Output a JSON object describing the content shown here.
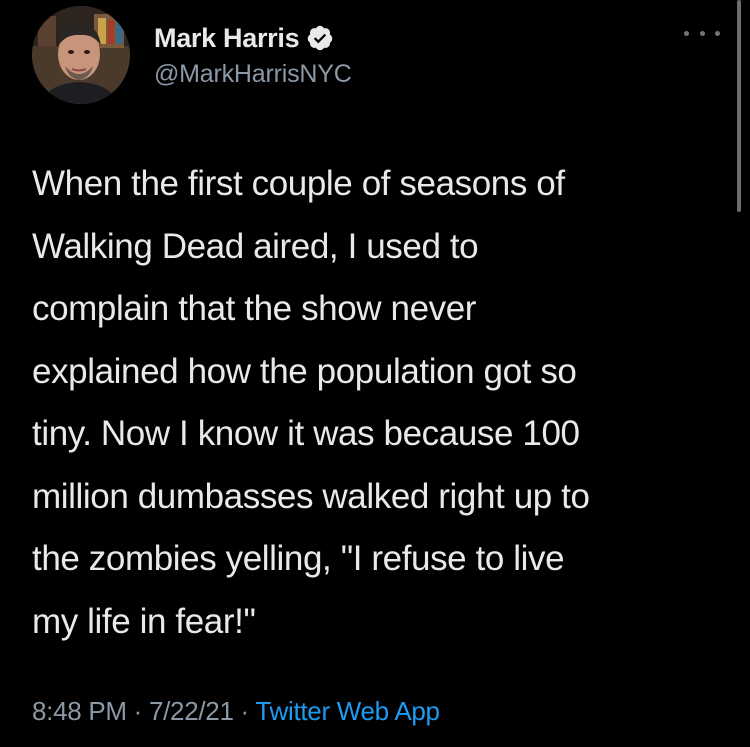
{
  "author": {
    "display_name": "Mark Harris",
    "handle": "@MarkHarrisNYC",
    "verified": true,
    "avatar_icon": "profile-photo"
  },
  "more_icon": "ellipsis-icon",
  "tweet": {
    "lines": [
      "When the first couple of seasons of",
      "Walking Dead aired, I used to",
      "complain that the show never",
      "explained how the population got so",
      "tiny. Now I know it was because 100",
      "million dumbasses walked right up to",
      "the zombies yelling, \"I refuse to live",
      "my life in fear!\""
    ]
  },
  "meta": {
    "time": "8:48 PM",
    "separator": " · ",
    "date": "7/22/21",
    "source": "Twitter Web App"
  },
  "colors": {
    "background": "#000000",
    "text": "#e7e9ea",
    "secondary": "#8b98a5",
    "accent": "#1d9bf0"
  }
}
